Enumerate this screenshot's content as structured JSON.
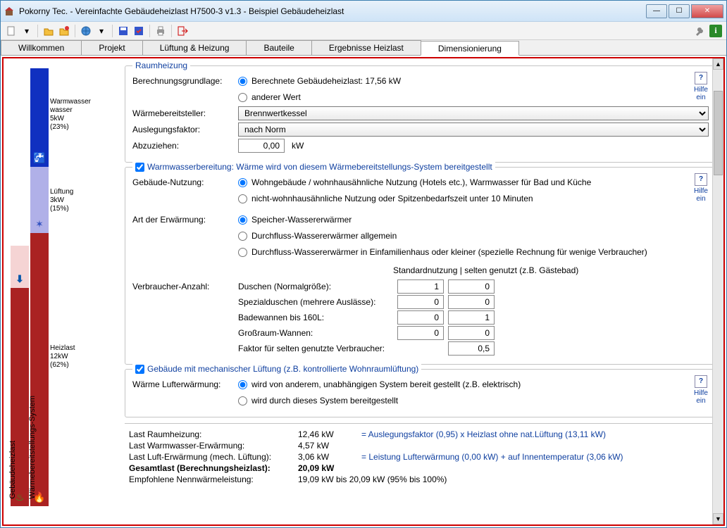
{
  "window": {
    "title": "Pokorny Tec.  -  Vereinfachte Gebäudeheizlast H7500-3 v1.3  -  Beispiel Gebäudeheizlast"
  },
  "tabs": [
    "Willkommen",
    "Projekt",
    "Lüftung & Heizung",
    "Bauteile",
    "Ergebnisse Heizlast",
    "Dimensionierung"
  ],
  "active_tab": 5,
  "bars": {
    "left_label": "Gebäudeheizlast",
    "right_label": "Wärmebereitstellungs-System",
    "segments": [
      {
        "name": "Warmwasser",
        "value": "5kW",
        "pct": "(23%)"
      },
      {
        "name": "Lüftung",
        "value": "3kW",
        "pct": "(15%)"
      },
      {
        "name": "Heizlast",
        "value": "12kW",
        "pct": "(62%)"
      }
    ]
  },
  "raumheizung": {
    "legend": "Raumheizung",
    "basis_label": "Berechnungsgrundlage:",
    "basis_opt1": "Berechnete Gebäudeheizlast:   17,56 kW",
    "basis_opt2": "anderer Wert",
    "provider_label": "Wärmebereitsteller:",
    "provider_value": "Brennwertkessel",
    "factor_label": "Auslegungsfaktor:",
    "factor_value": "nach Norm",
    "subtract_label": "Abzuziehen:",
    "subtract_value": "0,00",
    "subtract_unit": "kW",
    "help": "Hilfe ein"
  },
  "ww": {
    "legend": "Warmwasserbereitung: Wärme wird von diesem Wärmebereitstellungs-System bereitgestellt",
    "nutzung_label": "Gebäude-Nutzung:",
    "nutzung_opt1": "Wohngebäude / wohnhausähnliche Nutzung (Hotels etc.), Warmwasser für Bad und Küche",
    "nutzung_opt2": "nicht-wohnhausähnliche Nutzung oder Spitzenbedarfszeit unter 10 Minuten",
    "art_label": "Art der Erwärmung:",
    "art_opt1": "Speicher-Wassererwärmer",
    "art_opt2": "Durchfluss-Wassererwärmer allgemein",
    "art_opt3": "Durchfluss-Wassererwärmer in Einfamilienhaus oder kleiner (spezielle Rechnung für wenige Verbraucher)",
    "col_header": "Standardnutzung | selten genutzt (z.B. Gästebad)",
    "anzahl_label": "Verbraucher-Anzahl:",
    "rows": [
      {
        "label": "Duschen (Normalgröße):",
        "std": "1",
        "selten": "0"
      },
      {
        "label": "Spezialduschen (mehrere Auslässe):",
        "std": "0",
        "selten": "0"
      },
      {
        "label": "Badewannen bis 160L:",
        "std": "0",
        "selten": "1"
      },
      {
        "label": "Großraum-Wannen:",
        "std": "0",
        "selten": "0"
      }
    ],
    "faktor_label": "Faktor für selten genutzte Verbraucher:",
    "faktor_value": "0,5",
    "help": "Hilfe ein"
  },
  "lueftung": {
    "legend": "Gebäude mit mechanischer Lüftung (z.B. kontrollierte Wohnraumlüftung)",
    "label": "Wärme Lufterwärmung:",
    "opt1": "wird von anderem, unabhängigen System bereit gestellt (z.B. elektrisch)",
    "opt2": "wird durch dieses System bereitgestellt",
    "help": "Hilfe ein"
  },
  "results": {
    "r1_label": "Last Raumheizung:",
    "r1_val": "12,46 kW",
    "r1_form": "= Auslegungsfaktor (0,95)  x  Heizlast ohne nat.Lüftung (13,11 kW)",
    "r2_label": "Last Warmwasser-Erwärmung:",
    "r2_val": "4,57 kW",
    "r3_label": "Last Luft-Erwärmung (mech. Lüftung):",
    "r3_val": "3,06 kW",
    "r3_form": "= Leistung Lufterwärmung (0,00 kW) + auf Innentemperatur (3,06 kW)",
    "r4_label": "Gesamtlast  (Berechnungsheizlast):",
    "r4_val": "20,09 kW",
    "r5_label": "Empfohlene Nennwärmeleistung:",
    "r5_val": "19,09 kW  bis  20,09 kW  (95% bis 100%)"
  }
}
